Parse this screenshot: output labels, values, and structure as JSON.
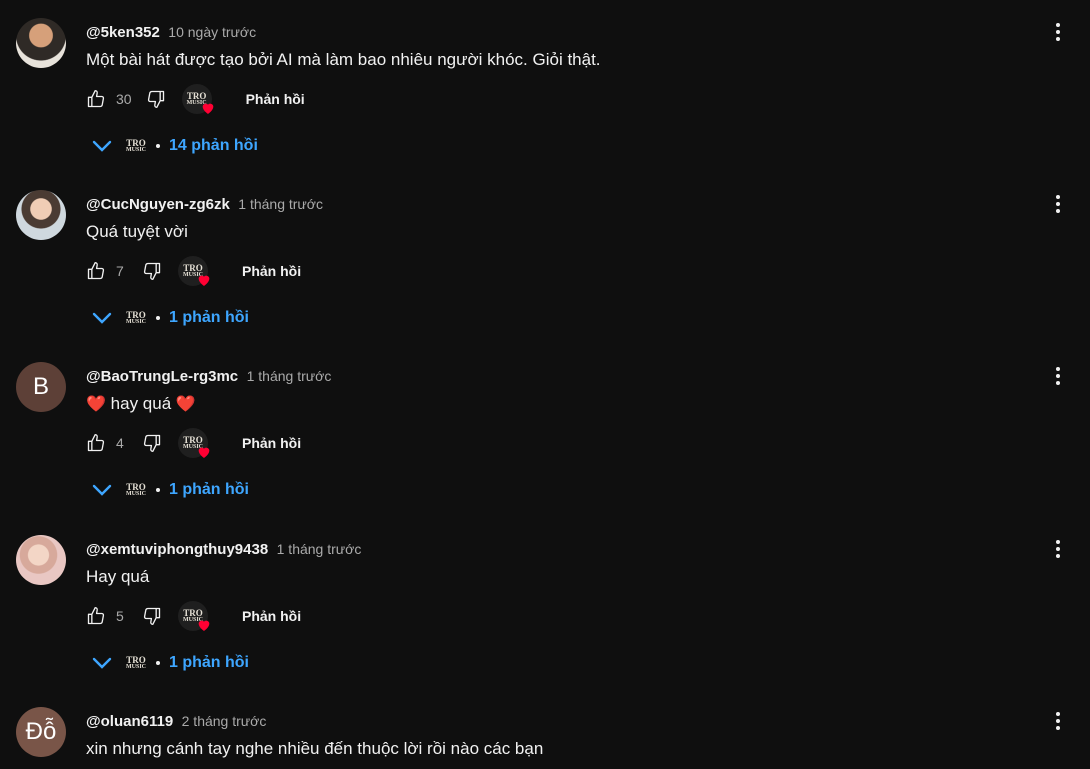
{
  "labels": {
    "reply_button": "Phản hồi",
    "creator_logo_top": "TRO",
    "creator_logo_bottom": "MUSIC"
  },
  "colors": {
    "background": "#0f0f0f",
    "accent_link": "#3ea6ff",
    "heart": "#ff0033",
    "muted_text": "#aaaaaa"
  },
  "icons": {
    "like": "thumb-up-outline-icon",
    "dislike": "thumb-down-outline-icon",
    "menu": "more-vertical-icon",
    "expand": "chevron-down-icon",
    "creator_heart": "heart-badge-icon"
  },
  "comments": [
    {
      "author": "@5ken352",
      "time": "10 ngày trước",
      "text": "Một bài hát được tạo bởi AI mà làm bao nhiêu người khóc. Giỏi thật.",
      "likes": "30",
      "replies": "14 phản hồi",
      "avatar_letter": ""
    },
    {
      "author": "@CucNguyen-zg6zk",
      "time": "1 tháng trước",
      "text": "Quá tuyệt vời",
      "likes": "7",
      "replies": "1 phản hồi",
      "avatar_letter": ""
    },
    {
      "author": "@BaoTrungLe-rg3mc",
      "time": "1 tháng trước",
      "text": "hay quá",
      "text_prefix_emoji": "❤️",
      "text_suffix_emoji": "❤️",
      "likes": "4",
      "replies": "1 phản hồi",
      "avatar_letter": "B"
    },
    {
      "author": "@xemtuviphongthuy9438",
      "time": "1 tháng trước",
      "text": "Hay quá",
      "likes": "5",
      "replies": "1 phản hồi",
      "avatar_letter": ""
    },
    {
      "author": "@oluan6119",
      "time": "2 tháng trước",
      "text": "xin nhưng cánh tay nghe nhiều đến thuộc lời rồi nào các bạn",
      "avatar_letter": "Đỗ"
    }
  ]
}
